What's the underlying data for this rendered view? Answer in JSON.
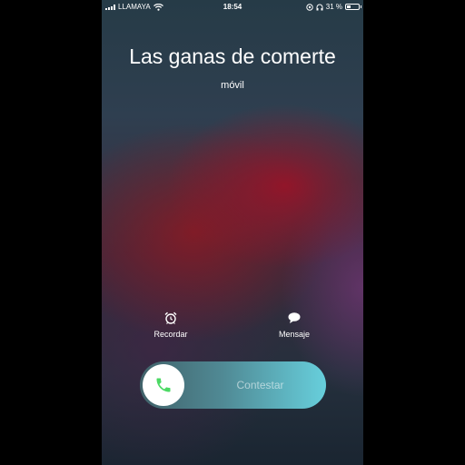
{
  "status_bar": {
    "carrier": "LLAMAYA",
    "time": "18:54",
    "battery": "31 %",
    "battery_level": 0.31
  },
  "call": {
    "caller_name": "Las ganas de comerte",
    "caller_label": "móvil"
  },
  "actions": {
    "remind_label": "Recordar",
    "message_label": "Mensaje"
  },
  "slider": {
    "label": "Contestar"
  },
  "colors": {
    "answer_green": "#4cd964",
    "slider_accent": "#67cfdc"
  }
}
